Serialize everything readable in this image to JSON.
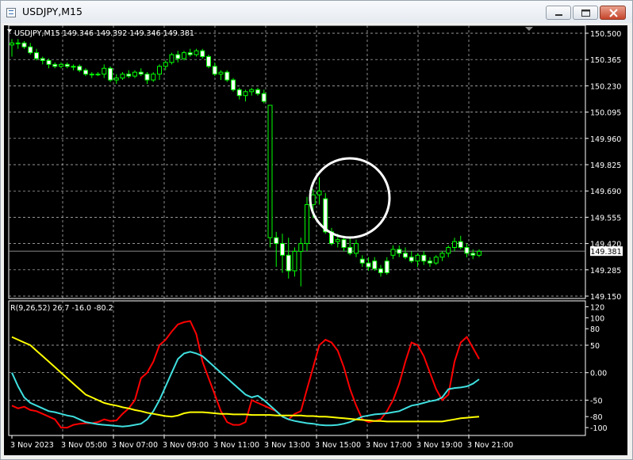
{
  "window": {
    "title": "USDJPY,M15",
    "controls": {
      "minimize_icon": "minimize-icon",
      "maximize_icon": "maximize-icon",
      "close_icon": "close-icon"
    }
  },
  "colors": {
    "background": "#000000",
    "grid": "#c8c8c8",
    "axis_text": "#ffffff",
    "bull_candle_body": "#000000",
    "bear_candle_body": "#ffffff",
    "candle_outline": "#00ff00",
    "line_red": "#ff0000",
    "line_cyan": "#40e0e0",
    "line_yellow": "#ffff00",
    "annotation_circle": "#ffffff",
    "price_marker_bg": "#ffffff",
    "price_marker_text": "#000000"
  },
  "chart_data": [
    {
      "type": "candlestick",
      "symbol_header": "USDJPY,M15  149.346 149.392 149.346 149.381",
      "current_price": "149.381",
      "ylim": [
        149.15,
        150.5
      ],
      "y_ticks": [
        "150.500",
        "150.365",
        "150.230",
        "150.095",
        "149.960",
        "149.825",
        "149.690",
        "149.555",
        "149.420",
        "149.285",
        "149.150"
      ],
      "x_ticks": [
        "3 Nov 2023",
        "3 Nov 05:00",
        "3 Nov 07:00",
        "3 Nov 09:00",
        "3 Nov 11:00",
        "3 Nov 13:00",
        "3 Nov 15:00",
        "3 Nov 17:00",
        "3 Nov 19:00",
        "3 Nov 21:00"
      ],
      "candles": [
        [
          150.44,
          150.47,
          150.38,
          150.45
        ],
        [
          150.45,
          150.47,
          150.42,
          150.45
        ],
        [
          150.45,
          150.46,
          150.42,
          150.43
        ],
        [
          150.43,
          150.45,
          150.39,
          150.4
        ],
        [
          150.4,
          150.42,
          150.36,
          150.37
        ],
        [
          150.37,
          150.38,
          150.34,
          150.36
        ],
        [
          150.36,
          150.37,
          150.32,
          150.34
        ],
        [
          150.34,
          150.35,
          150.32,
          150.33
        ],
        [
          150.33,
          150.35,
          150.32,
          150.34
        ],
        [
          150.34,
          150.35,
          150.32,
          150.33
        ],
        [
          150.33,
          150.34,
          150.31,
          150.33
        ],
        [
          150.33,
          150.34,
          150.3,
          150.31
        ],
        [
          150.31,
          150.32,
          150.28,
          150.29
        ],
        [
          150.29,
          150.3,
          150.27,
          150.29
        ],
        [
          150.29,
          150.3,
          150.28,
          150.29
        ],
        [
          150.29,
          150.34,
          150.27,
          150.32
        ],
        [
          150.32,
          150.33,
          150.25,
          150.26
        ],
        [
          150.26,
          150.29,
          150.24,
          150.27
        ],
        [
          150.27,
          150.3,
          150.26,
          150.29
        ],
        [
          150.29,
          150.31,
          150.27,
          150.28
        ],
        [
          150.28,
          150.31,
          150.27,
          150.3
        ],
        [
          150.3,
          150.32,
          150.28,
          150.29
        ],
        [
          150.29,
          150.3,
          150.24,
          150.26
        ],
        [
          150.26,
          150.3,
          150.25,
          150.29
        ],
        [
          150.29,
          150.34,
          150.26,
          150.33
        ],
        [
          150.33,
          150.36,
          150.31,
          150.35
        ],
        [
          150.35,
          150.4,
          150.34,
          150.39
        ],
        [
          150.39,
          150.41,
          150.35,
          150.37
        ],
        [
          150.37,
          150.41,
          150.36,
          150.4
        ],
        [
          150.4,
          150.42,
          150.38,
          150.39
        ],
        [
          150.39,
          150.42,
          150.38,
          150.41
        ],
        [
          150.41,
          150.42,
          150.37,
          150.38
        ],
        [
          150.38,
          150.39,
          150.32,
          150.33
        ],
        [
          150.33,
          150.35,
          150.28,
          150.29
        ],
        [
          150.29,
          150.31,
          150.26,
          150.3
        ],
        [
          150.3,
          150.31,
          150.25,
          150.26
        ],
        [
          150.26,
          150.27,
          150.2,
          150.21
        ],
        [
          150.21,
          150.22,
          150.16,
          150.18
        ],
        [
          150.18,
          150.21,
          150.15,
          150.2
        ],
        [
          150.2,
          150.22,
          150.18,
          150.21
        ],
        [
          150.21,
          150.22,
          150.18,
          150.19
        ],
        [
          150.19,
          150.21,
          150.14,
          150.15
        ],
        [
          149.45,
          150.13,
          149.4,
          150.13
        ],
        [
          149.45,
          149.48,
          149.3,
          149.42
        ],
        [
          149.42,
          149.47,
          149.27,
          149.36
        ],
        [
          149.36,
          149.45,
          149.24,
          149.28
        ],
        [
          149.28,
          149.4,
          149.25,
          149.38
        ],
        [
          149.38,
          149.45,
          149.2,
          149.42
        ],
        [
          149.42,
          149.66,
          149.38,
          149.62
        ],
        [
          149.62,
          149.7,
          149.55,
          149.67
        ],
        [
          149.67,
          149.76,
          149.62,
          149.69
        ],
        [
          149.65,
          149.68,
          149.47,
          149.48
        ],
        [
          149.48,
          149.5,
          149.41,
          149.42
        ],
        [
          149.43,
          149.47,
          149.4,
          149.44
        ],
        [
          149.44,
          149.46,
          149.38,
          149.4
        ],
        [
          149.4,
          149.45,
          149.36,
          149.37
        ],
        [
          149.37,
          149.44,
          149.35,
          149.42
        ],
        [
          149.34,
          149.36,
          149.3,
          149.32
        ],
        [
          149.32,
          149.35,
          149.28,
          149.3
        ],
        [
          149.33,
          149.35,
          149.28,
          149.29
        ],
        [
          149.29,
          149.31,
          149.25,
          149.27
        ],
        [
          149.33,
          149.35,
          149.26,
          149.27
        ],
        [
          149.36,
          149.41,
          149.34,
          149.39
        ],
        [
          149.39,
          149.41,
          149.35,
          149.37
        ],
        [
          149.37,
          149.4,
          149.34,
          149.35
        ],
        [
          149.35,
          149.38,
          149.32,
          149.33
        ],
        [
          149.33,
          149.37,
          149.3,
          149.36
        ],
        [
          149.36,
          149.38,
          149.31,
          149.33
        ],
        [
          149.33,
          149.35,
          149.3,
          149.32
        ],
        [
          149.32,
          149.36,
          149.31,
          149.35
        ],
        [
          149.35,
          149.38,
          149.33,
          149.37
        ],
        [
          149.37,
          149.41,
          149.35,
          149.4
        ],
        [
          149.4,
          149.45,
          149.38,
          149.43
        ],
        [
          149.43,
          149.46,
          149.39,
          149.4
        ],
        [
          149.4,
          149.42,
          149.35,
          149.37
        ],
        [
          149.37,
          149.39,
          149.34,
          149.36
        ],
        [
          149.36,
          149.39,
          149.35,
          149.38
        ]
      ]
    },
    {
      "type": "line",
      "header": "R(9,26,52) 26.7 -16.0 -80.2",
      "ylim": [
        -110,
        125
      ],
      "y_ticks": [
        "120",
        "100",
        "80",
        "50",
        "0.00",
        "-50",
        "-80",
        "-100"
      ],
      "series": [
        {
          "color": "red",
          "values": [
            -60,
            -65,
            -62,
            -68,
            -70,
            -75,
            -80,
            -85,
            -100,
            -100,
            -95,
            -93,
            -92,
            -92,
            -90,
            -85,
            -88,
            -87,
            -75,
            -65,
            -50,
            -10,
            0,
            20,
            50,
            60,
            75,
            88,
            92,
            94,
            70,
            20,
            -10,
            -40,
            -70,
            -90,
            -95,
            -95,
            -90,
            -50,
            -55,
            -60,
            -65,
            -70,
            -80,
            -85,
            -75,
            -70,
            -30,
            10,
            50,
            60,
            55,
            40,
            10,
            -30,
            -60,
            -85,
            -90,
            -88,
            -85,
            -70,
            -50,
            -20,
            20,
            55,
            50,
            30,
            0,
            -30,
            -50,
            -40,
            20,
            55,
            65,
            45,
            25
          ]
        },
        {
          "color": "cyan",
          "values": [
            0,
            -25,
            -45,
            -55,
            -60,
            -65,
            -70,
            -72,
            -75,
            -78,
            -80,
            -85,
            -90,
            -92,
            -94,
            -95,
            -96,
            -97,
            -98,
            -97,
            -95,
            -93,
            -85,
            -70,
            -50,
            -25,
            0,
            25,
            35,
            38,
            35,
            30,
            20,
            10,
            0,
            -10,
            -20,
            -30,
            -40,
            -45,
            -42,
            -50,
            -60,
            -70,
            -80,
            -85,
            -88,
            -90,
            -92,
            -93,
            -95,
            -96,
            -96,
            -95,
            -93,
            -90,
            -85,
            -80,
            -78,
            -76,
            -75,
            -74,
            -72,
            -70,
            -65,
            -60,
            -58,
            -55,
            -52,
            -50,
            -45,
            -30,
            -28,
            -27,
            -25,
            -20,
            -12
          ]
        },
        {
          "color": "yellow",
          "values": [
            65,
            60,
            55,
            50,
            40,
            30,
            20,
            10,
            0,
            -10,
            -20,
            -30,
            -40,
            -45,
            -50,
            -55,
            -58,
            -60,
            -63,
            -65,
            -68,
            -70,
            -73,
            -75,
            -77,
            -79,
            -80,
            -78,
            -74,
            -72,
            -72,
            -72,
            -73,
            -74,
            -75,
            -75,
            -76,
            -76,
            -76,
            -77,
            -77,
            -77,
            -77,
            -78,
            -78,
            -78,
            -78,
            -78,
            -79,
            -79,
            -80,
            -80,
            -81,
            -82,
            -83,
            -84,
            -85,
            -86,
            -87,
            -88,
            -88,
            -89,
            -89,
            -89,
            -89,
            -89,
            -89,
            -89,
            -89,
            -89,
            -89,
            -87,
            -85,
            -83,
            -82,
            -81,
            -80
          ]
        }
      ]
    }
  ]
}
